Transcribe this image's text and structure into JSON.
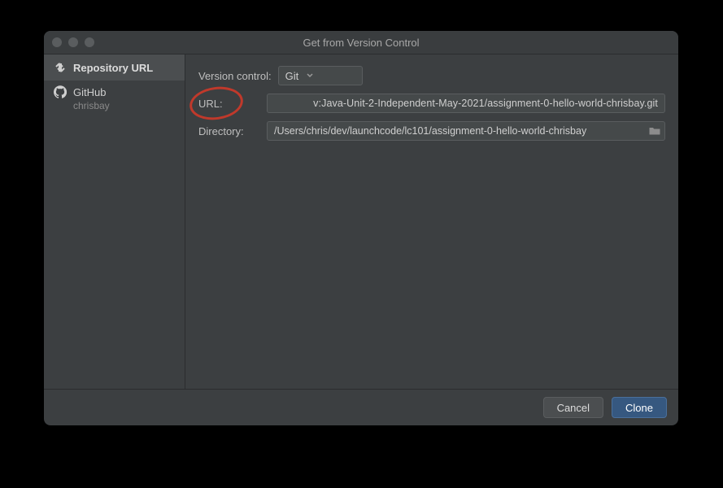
{
  "window": {
    "title": "Get from Version Control"
  },
  "sidebar": {
    "items": [
      {
        "label": "Repository URL"
      },
      {
        "label": "GitHub",
        "user": "chrisbay"
      }
    ]
  },
  "form": {
    "vcs_label": "Version control:",
    "vcs_value": "Git",
    "url_label": "URL:",
    "url_value": "v:Java-Unit-2-Independent-May-2021/assignment-0-hello-world-chrisbay.git",
    "dir_label": "Directory:",
    "dir_value": "/Users/chris/dev/launchcode/lc101/assignment-0-hello-world-chrisbay"
  },
  "buttons": {
    "cancel": "Cancel",
    "clone": "Clone"
  }
}
